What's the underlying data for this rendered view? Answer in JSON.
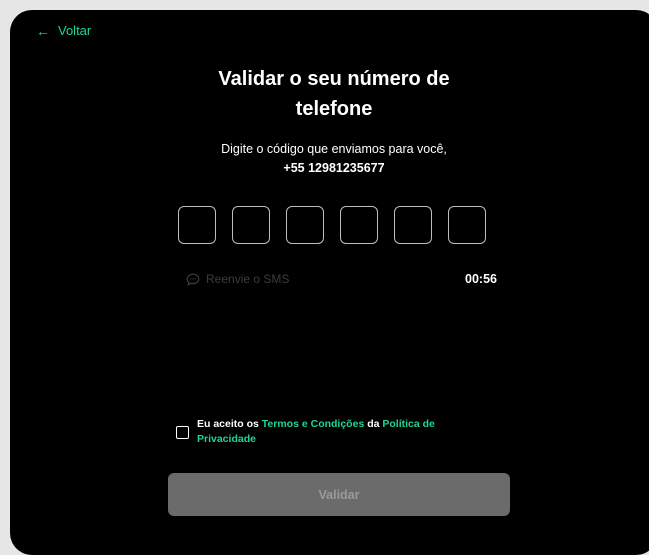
{
  "nav": {
    "back_label": "Voltar"
  },
  "header": {
    "title_line1": "Validar o seu número de",
    "title_line2": "telefone",
    "subtitle": "Digite o código que enviamos para você,",
    "phone": "+55 12981235677"
  },
  "otp": {
    "length": 6
  },
  "resend": {
    "label": "Reenvie o SMS",
    "icon": "chat-bubble-icon",
    "timer": "00:56"
  },
  "terms": {
    "prefix": "Eu aceito os ",
    "terms_link": "Termos e Condições",
    "middle": " da ",
    "privacy_link_line1": "Política de",
    "privacy_link_line2": "Privacidade"
  },
  "submit": {
    "label": "Validar"
  },
  "colors": {
    "accent": "#1fd39a",
    "background": "#000000",
    "button_disabled": "#6b6b6b"
  }
}
